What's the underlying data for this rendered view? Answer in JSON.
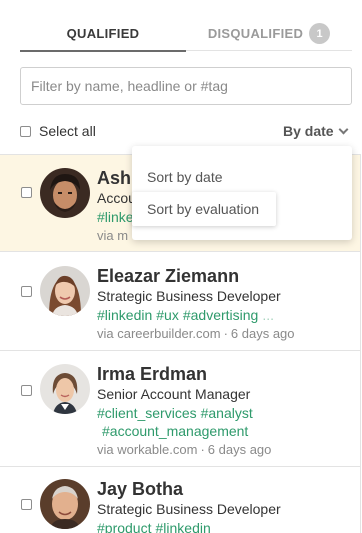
{
  "tabs": {
    "qualified": "QUALIFIED",
    "disqualified": "DISQUALIFIED",
    "disqualified_count": "1"
  },
  "search": {
    "placeholder": "Filter by name, headline or #tag"
  },
  "select_all_label": "Select all",
  "sort": {
    "current": "By date",
    "options": [
      "Sort by date",
      "Sort by evaluation"
    ]
  },
  "candidates": [
    {
      "name": "Ash",
      "title": "Accou",
      "tags": [
        "#linke"
      ],
      "via_prefix": "via ",
      "source": "m",
      "time": "",
      "selected": true
    },
    {
      "name": "Eleazar Ziemann",
      "title": "Strategic Business Developer",
      "tags": [
        "#linkedin",
        "#ux",
        "#advertising",
        "..."
      ],
      "via_prefix": "via ",
      "source": "careerbuilder.com",
      "time": "6 days ago",
      "selected": false
    },
    {
      "name": "Irma Erdman",
      "title": "Senior Account Manager",
      "tags": [
        "#client_services",
        "#analyst",
        "#account_management"
      ],
      "via_prefix": "via ",
      "source": "workable.com",
      "time": "6 days ago",
      "selected": false
    },
    {
      "name": "Jay Botha",
      "title": "Strategic Business Developer",
      "tags": [
        "#product",
        "#linkedin"
      ],
      "via_prefix": "",
      "source": "",
      "time": "",
      "selected": false
    }
  ],
  "colors": {
    "tag_green": "#2e9a6b",
    "selected_row_bg": "#fdf6e3",
    "badge_bg": "#c8c8c8"
  }
}
